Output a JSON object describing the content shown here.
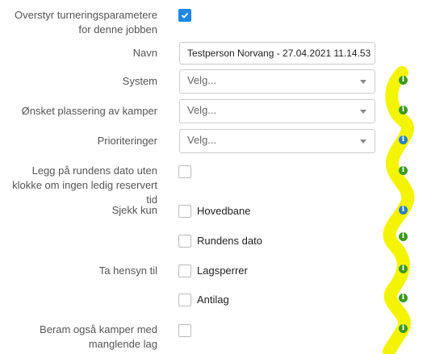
{
  "override": {
    "label": "Overstyr turneringsparametere for denne jobben",
    "checked": true
  },
  "navn": {
    "label": "Navn",
    "value": "Testperson Norvang - 27.04.2021 11.14.53"
  },
  "system": {
    "label": "System",
    "placeholder": "Velg..."
  },
  "plassering": {
    "label": "Ønsket plassering av kamper",
    "placeholder": "Velg..."
  },
  "prioriteringer": {
    "label": "Prioriteringer",
    "placeholder": "Velg..."
  },
  "legg_paa": {
    "label": "Legg på rundens dato uten klokke om ingen ledig reservert tid"
  },
  "sjekk_kun": {
    "label": "Sjekk kun",
    "options": [
      {
        "label": "Hovedbane"
      },
      {
        "label": "Rundens dato"
      }
    ]
  },
  "ta_hensyn": {
    "label": "Ta hensyn til",
    "options": [
      {
        "label": "Lagsperrer"
      },
      {
        "label": "Antilag"
      }
    ]
  },
  "beram": {
    "label": "Beram også kamper med manglende lag"
  },
  "info_icon": {
    "glyph": "i"
  },
  "colors": {
    "accent": "#1e88e5",
    "info_green": "#3b9a1f",
    "info_blue": "#2b7fc6",
    "highlight": "#f4f400"
  }
}
